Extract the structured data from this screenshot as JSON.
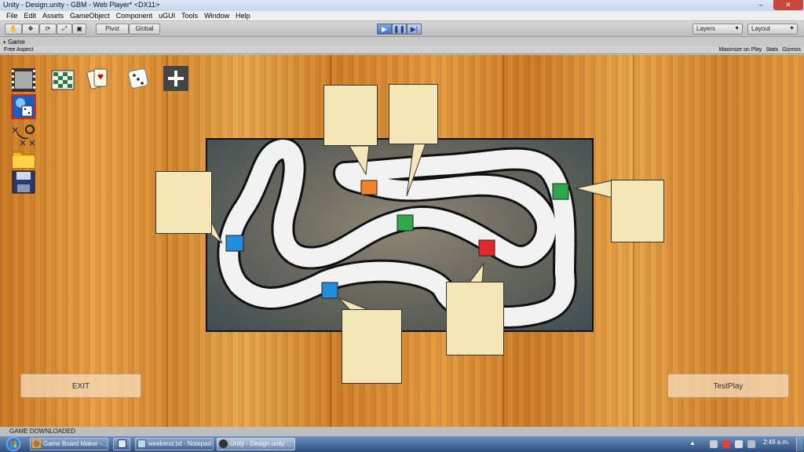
{
  "window": {
    "title": "Unity - Design.unity - GBM - Web Player* <DX11>"
  },
  "menu": [
    "File",
    "Edit",
    "Assets",
    "GameObject",
    "Component",
    "uGUI",
    "Tools",
    "Window",
    "Help"
  ],
  "toolbar": {
    "pivot_label": "Pivot",
    "global_label": "Global",
    "layers_label": "Layers",
    "layout_label": "Layout"
  },
  "game_panel": {
    "tab_label": "Game",
    "aspect_label": "Free Aspect",
    "maximize_label": "Maximize on Play",
    "stats_label": "Stats",
    "gizmos_label": "Gizmos"
  },
  "game": {
    "exit_label": "EXIT",
    "testplay_label": "TestPlay"
  },
  "status": {
    "message": "GAME DOWNLOADED"
  },
  "taskbar": {
    "tasks": [
      "Game Board Maker -...",
      "weekend.txt - Notepad",
      "Unity - Design.unity ..."
    ],
    "clock": "2:49 a.m."
  },
  "colors": {
    "tile_orange": "#f0842a",
    "tile_green": "#2fa84a",
    "tile_red": "#e02a2a",
    "tile_blue": "#1f8fdc",
    "bubble": "#f5e6b5"
  }
}
